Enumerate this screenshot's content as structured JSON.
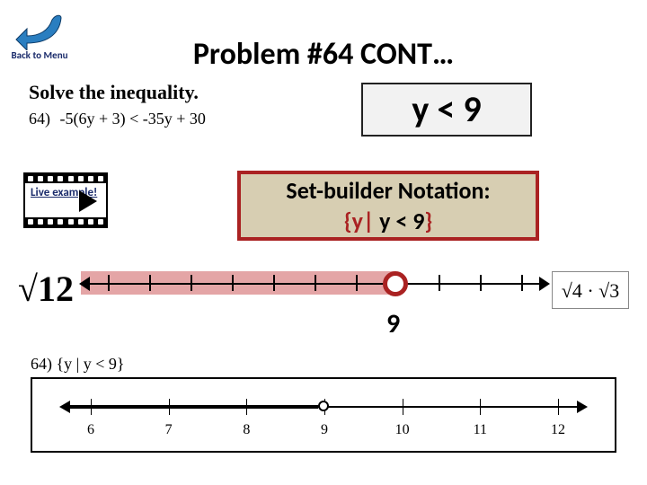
{
  "back_button": {
    "label": "Back to Menu"
  },
  "title": "Problem #64 CONT…",
  "solve": {
    "heading": "Solve the inequality.",
    "number": "64)",
    "expression": "-5(6y + 3) < -35y + 30"
  },
  "answer": "y < 9",
  "live_example_label": "Live example!",
  "set_builder": {
    "title": "Set-builder Notation:",
    "prefix": "{y|",
    "expr": " y < 9",
    "suffix": "}"
  },
  "mid_numberline": {
    "label": "9",
    "tick_count": 11,
    "open_point_index": 9
  },
  "sqrt_left": "√12",
  "sqrt_right": "√4 · √3",
  "answer_set_builder": "64) {y | y < 9}",
  "bottom_numberline": {
    "labels": [
      "6",
      "7",
      "8",
      "9",
      "10",
      "11",
      "12"
    ],
    "open_point_value": "9"
  },
  "colors": {
    "accent_red": "#aa2222",
    "highlight": "#d67476",
    "box_bg": "#d7ceb2",
    "link": "#1a2b6b"
  }
}
